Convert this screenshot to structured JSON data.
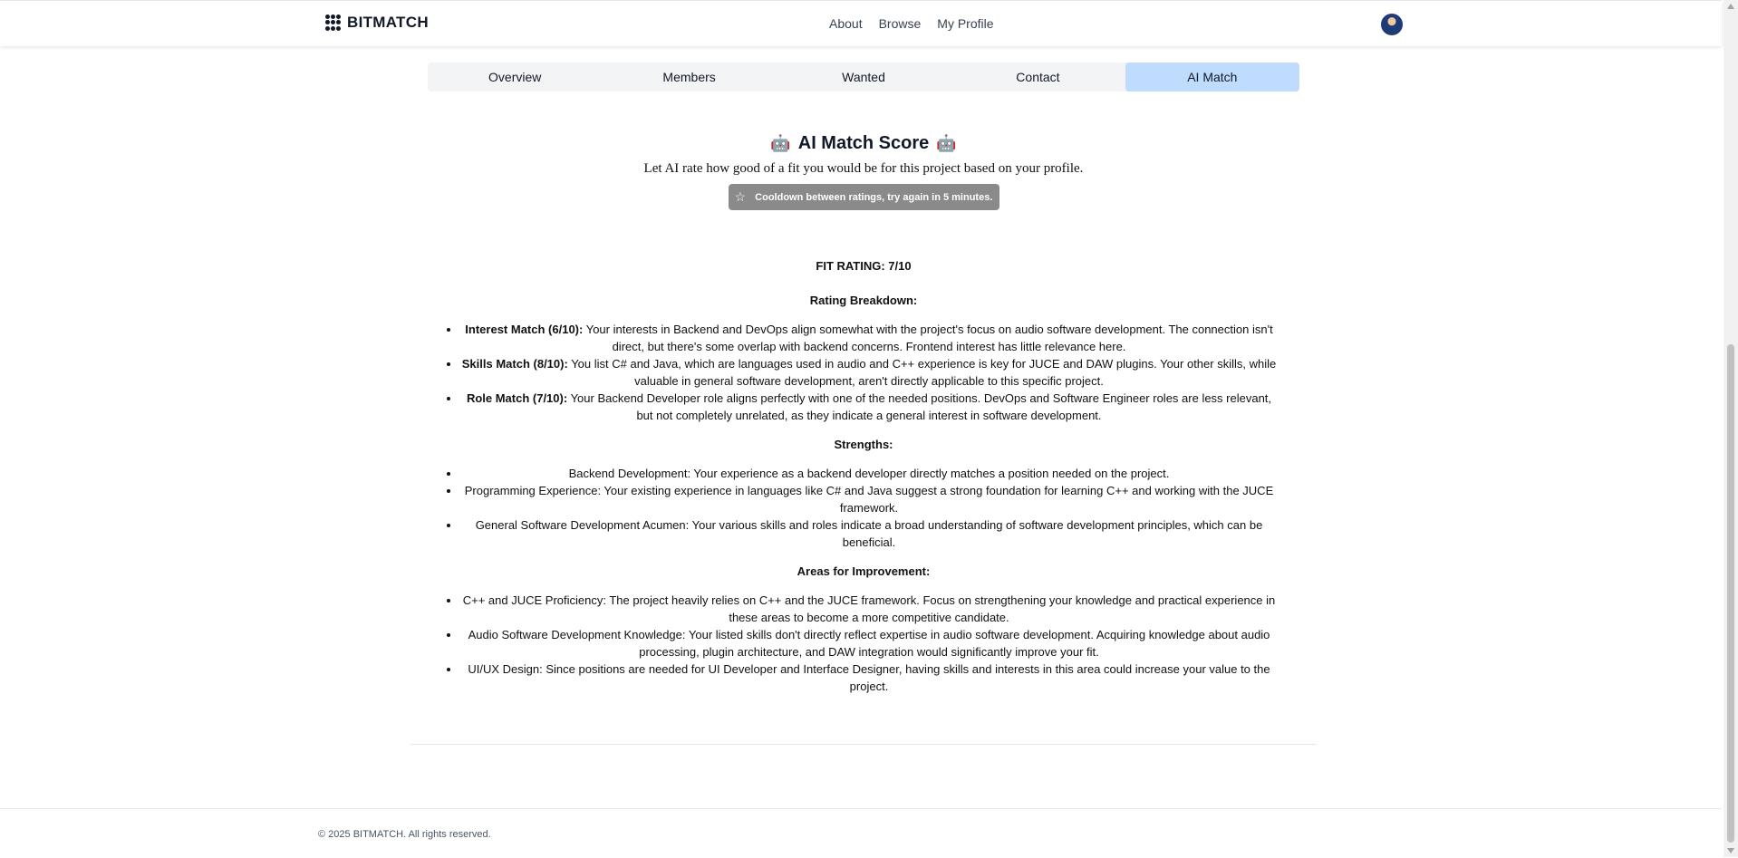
{
  "header": {
    "logo_text": "BITMATCH",
    "nav": [
      "About",
      "Browse",
      "My Profile"
    ]
  },
  "tabs": [
    "Overview",
    "Members",
    "Wanted",
    "Contact",
    "AI Match"
  ],
  "active_tab": "AI Match",
  "ai_match": {
    "title": "AI Match Score",
    "emoji": "🤖",
    "subtitle": "Let AI rate how good of a fit you would be for this project based on your profile.",
    "cooldown": "Cooldown between ratings, try again in 5 minutes."
  },
  "report": {
    "fit_rating": "FIT RATING: 7/10",
    "breakdown_heading": "Rating Breakdown:",
    "breakdown": [
      {
        "label": "Interest Match (6/10):",
        "text": " Your interests in Backend and DevOps align somewhat with the project's focus on audio software development. The connection isn't direct, but there's some overlap with backend concerns. Frontend interest has little relevance here."
      },
      {
        "label": "Skills Match (8/10):",
        "text": " You list C# and Java, which are languages used in audio and C++ experience is key for JUCE and DAW plugins. Your other skills, while valuable in general software development, aren't directly applicable to this specific project."
      },
      {
        "label": "Role Match (7/10):",
        "text": " Your Backend Developer role aligns perfectly with one of the needed positions. DevOps and Software Engineer roles are less relevant, but not completely unrelated, as they indicate a general interest in software development."
      }
    ],
    "strengths_heading": "Strengths:",
    "strengths": [
      "Backend Development: Your experience as a backend developer directly matches a position needed on the project.",
      "Programming Experience: Your existing experience in languages like C# and Java suggest a strong foundation for learning C++ and working with the JUCE framework.",
      "General Software Development Acumen: Your various skills and roles indicate a broad understanding of software development principles, which can be beneficial."
    ],
    "improvement_heading": "Areas for Improvement:",
    "improvements": [
      "C++ and JUCE Proficiency: The project heavily relies on C++ and the JUCE framework. Focus on strengthening your knowledge and practical experience in these areas to become a more competitive candidate.",
      "Audio Software Development Knowledge: Your listed skills don't directly reflect expertise in audio software development. Acquiring knowledge about audio processing, plugin architecture, and DAW integration would significantly improve your fit.",
      "UI/UX Design: Since positions are needed for UI Developer and Interface Designer, having skills and interests in this area could increase your value to the project."
    ]
  },
  "footer": {
    "copyright": "© 2025 BITMATCH. All rights reserved."
  },
  "colors": {
    "active_tab": "#bfdbfe",
    "tab_bar": "#f3f4f6",
    "cooldown_button": "#8a8a8a"
  }
}
